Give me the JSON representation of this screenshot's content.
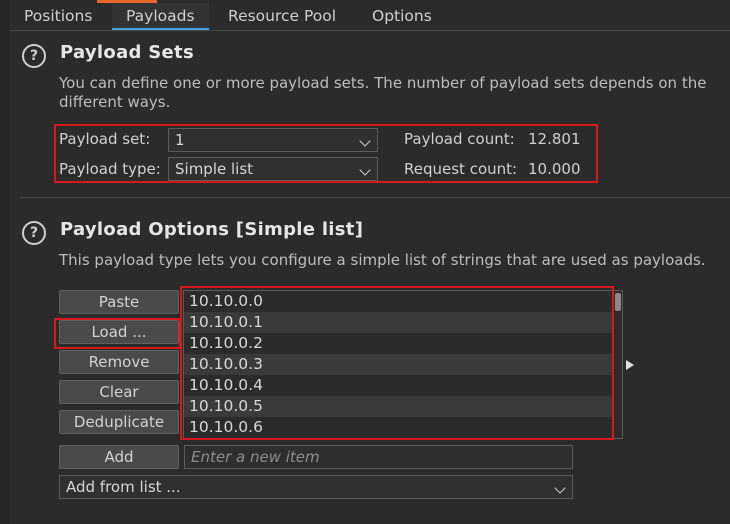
{
  "tabs": [
    {
      "label": "Positions"
    },
    {
      "label": "Payloads"
    },
    {
      "label": "Resource Pool"
    },
    {
      "label": "Options"
    }
  ],
  "payload_sets": {
    "help": "?",
    "title": "Payload Sets",
    "desc_line1": "You can define one or more payload sets. The number of payload sets depends on the",
    "desc_line2": "different ways.",
    "set_label": "Payload set:",
    "set_value": "1",
    "type_label": "Payload type:",
    "type_value": "Simple list",
    "count_label": "Payload count:",
    "count_value": "12.801",
    "request_label": "Request count:",
    "request_value": "10.000"
  },
  "payload_options": {
    "help": "?",
    "title": "Payload Options [Simple list]",
    "desc": "This payload type lets you configure a simple list of strings that are used as payloads.",
    "buttons": {
      "paste": "Paste",
      "load": "Load ...",
      "remove": "Remove",
      "clear": "Clear",
      "deduplicate": "Deduplicate",
      "add": "Add"
    },
    "items": [
      "10.10.0.0",
      "10.10.0.1",
      "10.10.0.2",
      "10.10.0.3",
      "10.10.0.4",
      "10.10.0.5",
      "10.10.0.6"
    ],
    "new_item_placeholder": "Enter a new item",
    "add_from_list": "Add from list ..."
  },
  "colors": {
    "background": "#2b2b2b",
    "highlight_border": "#d8191c",
    "active_tab_underline": "#3f9fe0",
    "accent": "#e8672a"
  }
}
